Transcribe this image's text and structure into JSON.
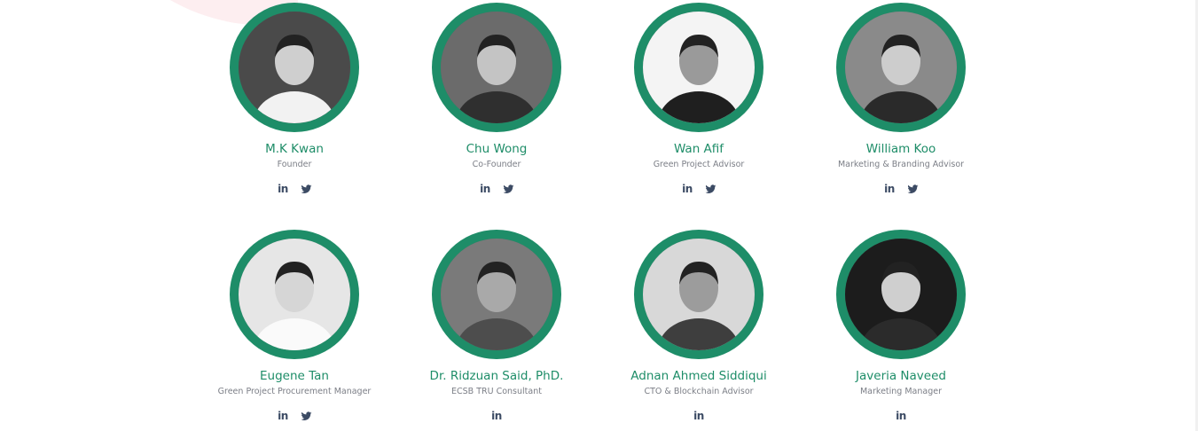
{
  "team": [
    {
      "name": "M.K Kwan",
      "role": "Founder",
      "socials": [
        "linkedin",
        "twitter"
      ],
      "bg": "#4a4a4a",
      "skin": "#cfcfcf",
      "shirt": "#f2f2f2"
    },
    {
      "name": "Chu Wong",
      "role": "Co-Founder",
      "socials": [
        "linkedin",
        "twitter"
      ],
      "bg": "#6b6b6b",
      "skin": "#c4c4c4",
      "shirt": "#2f2f2f"
    },
    {
      "name": "Wan Afif",
      "role": "Green Project Advisor",
      "socials": [
        "linkedin",
        "twitter"
      ],
      "bg": "#f4f4f4",
      "skin": "#9a9a9a",
      "shirt": "#1f1f1f"
    },
    {
      "name": "William Koo",
      "role": "Marketing & Branding Advisor",
      "socials": [
        "linkedin",
        "twitter"
      ],
      "bg": "#8a8a8a",
      "skin": "#cdcdcd",
      "shirt": "#2a2a2a"
    },
    {
      "name": "Eugene Tan",
      "role": "Green Project Procurement Manager",
      "socials": [
        "linkedin",
        "twitter"
      ],
      "bg": "#e6e6e6",
      "skin": "#d6d6d6",
      "shirt": "#fafafa"
    },
    {
      "name": "Dr. Ridzuan Said, PhD.",
      "role": "ECSB TRU Consultant",
      "socials": [
        "linkedin"
      ],
      "bg": "#7a7a7a",
      "skin": "#a9a9a9",
      "shirt": "#4d4d4d"
    },
    {
      "name": "Adnan Ahmed Siddiqui",
      "role": "CTO & Blockchain Advisor",
      "socials": [
        "linkedin"
      ],
      "bg": "#d8d8d8",
      "skin": "#9c9c9c",
      "shirt": "#3e3e3e"
    },
    {
      "name": "Javeria Naveed",
      "role": "Marketing Manager",
      "socials": [
        "linkedin"
      ],
      "bg": "#1c1c1c",
      "skin": "#cfcfcf",
      "shirt": "#2b2b2b"
    }
  ],
  "colors": {
    "accent": "#1e8d68",
    "name": "#1e8d68",
    "role": "#7b7e86",
    "icon": "#3c4b64"
  },
  "icons": {
    "linkedin": "linkedin-icon",
    "twitter": "twitter-icon"
  }
}
